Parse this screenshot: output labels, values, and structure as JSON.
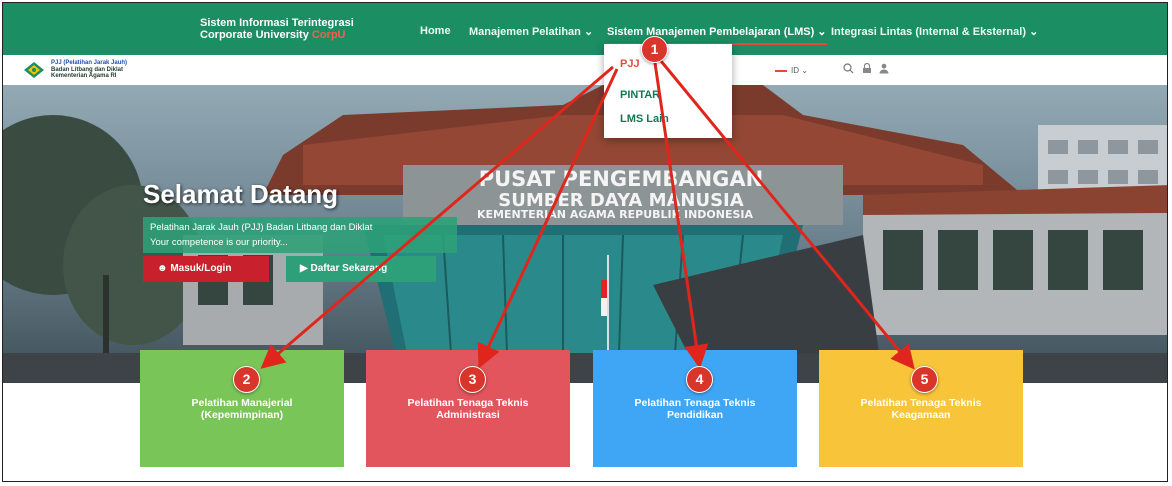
{
  "header": {
    "brand_line1": "Sistem Informasi Terintegrasi",
    "brand_line2": "Corporate University",
    "brand_accent": "CorpU",
    "nav": [
      {
        "label": "Home",
        "dropdown": false
      },
      {
        "label": "Manajemen Pelatihan",
        "dropdown": true
      },
      {
        "label": "Sistem Manajemen Pembelajaran (LMS)",
        "dropdown": true,
        "active": true
      },
      {
        "label": "Integrasi Lintas (Internal & Eksternal)",
        "dropdown": true
      }
    ]
  },
  "subheader": {
    "logo_line1": "PJJ (Pelatihan Jarak Jauh)",
    "logo_line2": "Badan Litbang dan Diklat",
    "logo_line3": "Kementerian Agama RI",
    "language": "ID",
    "icons": [
      "search-icon",
      "lock-icon",
      "user-icon"
    ]
  },
  "dropdown": {
    "items": [
      "PJJ",
      "PINTAR",
      "LMS Lain"
    ],
    "selected": "PJJ"
  },
  "hero": {
    "title": "Selamat Datang",
    "tagline_line1": "Pelatihan Jarak Jauh (PJJ) Badan Litbang dan Diklat",
    "tagline_line2": "Your competence is our priority...",
    "login_label": "Masuk/Login",
    "register_label": "Daftar Sekarang",
    "building_line1": "PUSAT PENGEMBANGAN",
    "building_line2": "SUMBER DAYA MANUSIA",
    "building_line3": "KEMENTERIAN AGAMA REPUBLIK INDONESIA"
  },
  "cards": [
    {
      "title_line1": "Pelatihan Manajerial",
      "title_line2": "(Kepemimpinan)",
      "color": "#7ac558"
    },
    {
      "title_line1": "Pelatihan Tenaga Teknis",
      "title_line2": "Administrasi",
      "color": "#e3555c"
    },
    {
      "title_line1": "Pelatihan Tenaga Teknis",
      "title_line2": "Pendidikan",
      "color": "#3fa6f5"
    },
    {
      "title_line1": "Pelatihan Tenaga Teknis",
      "title_line2": "Keagamaan",
      "color": "#f8c43a"
    }
  ],
  "markers": [
    "1",
    "2",
    "3",
    "4",
    "5"
  ],
  "colors": {
    "topbar": "#1b8e63",
    "accent_red": "#e34a3e",
    "arrow": "#e0261c"
  }
}
